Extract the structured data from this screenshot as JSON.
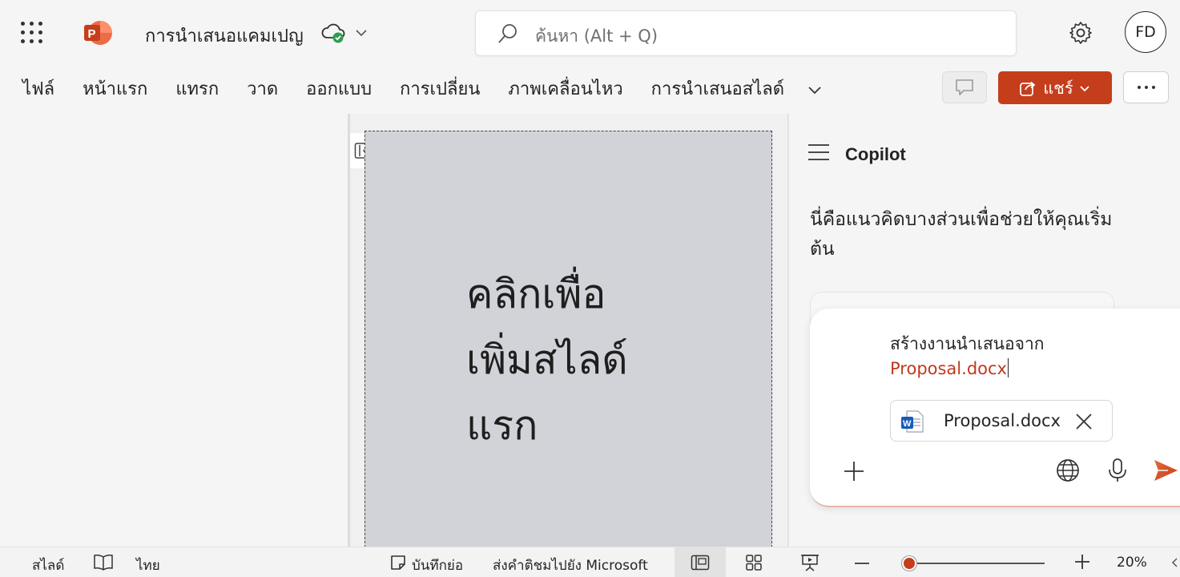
{
  "titlebar": {
    "doc_title": "การนำเสนอแคมเปญ",
    "search_placeholder": "ค้นหา (Alt + Q)",
    "avatar_initials": "FD",
    "app_icon": "powerpoint-icon",
    "cloud_status_icon": "cloud-saved-icon"
  },
  "ribbon": {
    "tabs": [
      "ไฟล์",
      "หน้าแรก",
      "แทรก",
      "วาด",
      "ออกแบบ",
      "การเปลี่ยน",
      "ภาพเคลื่อนไหว",
      "การนำเสนอสไลด์"
    ],
    "share_label": "แชร์",
    "more_icon": "ellipsis-icon"
  },
  "slide": {
    "placeholder": "คลิกเพื่อ\nเพิ่มสไลด์\nแรก"
  },
  "copilot": {
    "title": "Copilot",
    "intro": "นี่คือแนวคิดบางส่วนเพื่อช่วยให้คุณเริ่มต้น",
    "prompt_line1": "สร้างงานนำเสนอจาก",
    "prompt_line2": "Proposal.docx",
    "attachment_name": "Proposal.docx"
  },
  "status": {
    "slide_label": "สไลด์",
    "language": "ไทย",
    "notes_label": "บันทึกย่อ",
    "feedback_label": "ส่งคำติชมไปยัง Microsoft",
    "zoom_percent": "20%",
    "zoom_value": 20
  },
  "colors": {
    "accent": "#c43e1c",
    "slide_bg": "#d2d3d8",
    "link_red": "#c0391f"
  }
}
